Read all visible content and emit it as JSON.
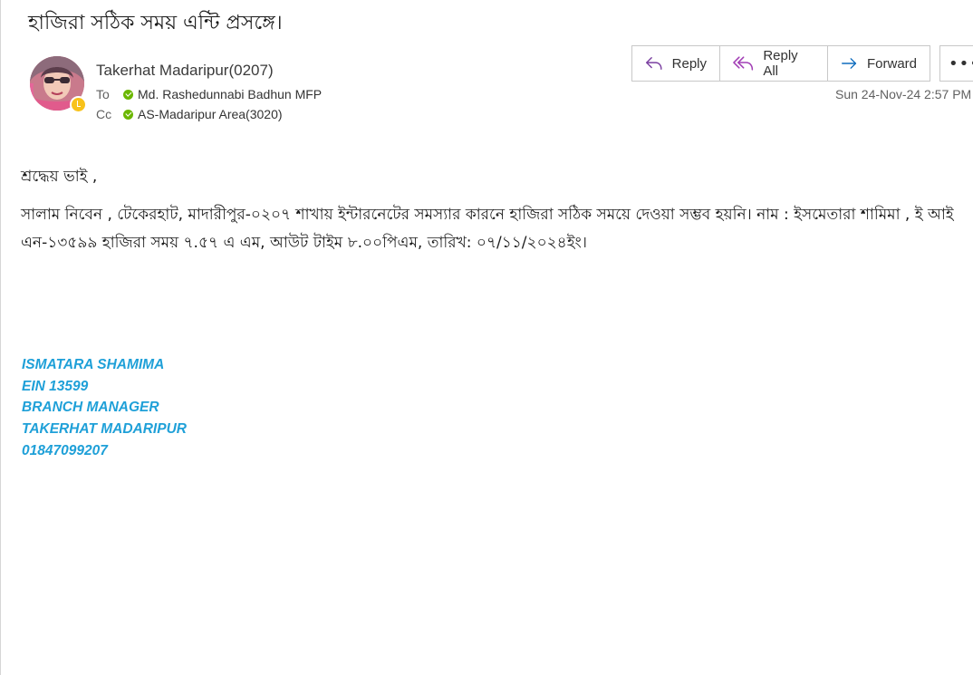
{
  "subject": "হাজিরা সঠিক  সময় এন্টি প্রসঙ্গে।",
  "sender": {
    "name": "Takerhat Madaripur(0207)",
    "avatar_icon": "user-avatar",
    "presence_color": "#f8c21a"
  },
  "recipients": {
    "to_label": "To",
    "to_name": "Md. Rashedunnabi Badhun MFP",
    "cc_label": "Cc",
    "cc_name": "AS-Madaripur Area(3020)",
    "status_color": "#6bb700"
  },
  "actions": {
    "reply": "Reply",
    "reply_all": "Reply All",
    "forward": "Forward",
    "more": "•••"
  },
  "date": "Sun 24-Nov-24 2:57 PM",
  "body": {
    "greeting": "শ্রদ্ধেয় ভাই ,",
    "paragraph": "সালাম নিবেন , টেকেরহাট, মাদারীপুর-০২০৭ শাখায় ইন্টারনেটের সমস্যার কারনে হাজিরা সঠিক সময়ে দেওয়া সম্ভব হয়নি।  নাম : ইসমেতারা শামিমা , ই আই এন-১৩৫৯৯ হাজিরা সময় ৭.৫৭ এ এম, আউট টাইম ৮.০০পিএম, তারিখ: ০৭/১১/২০২৪ইং।"
  },
  "signature": {
    "line1": "ISMATARA SHAMIMA",
    "line2": "EIN 13599",
    "line3": "BRANCH MANAGER",
    "line4": "TAKERHAT MADARIPUR",
    "line5": "01847099207",
    "color": "#1fa0d8"
  },
  "colors": {
    "accent": "#0f6cbd",
    "reply_all_icon": "#a23fb5"
  }
}
